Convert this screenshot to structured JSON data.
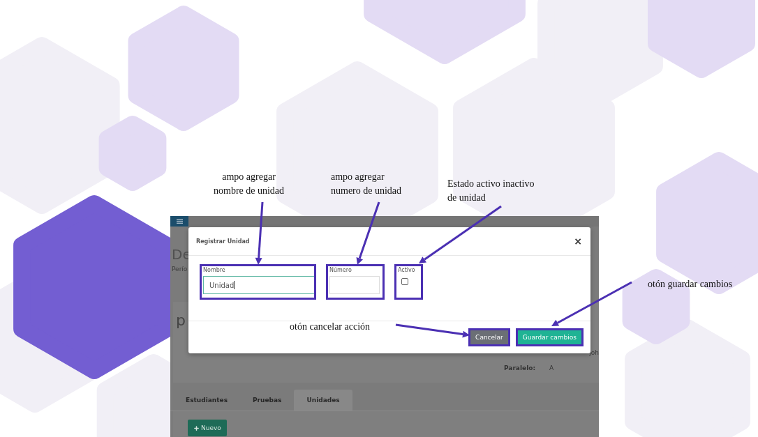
{
  "annotations": [
    {
      "text": "ampo agregar\nnombre de unidad"
    },
    {
      "text": "ampo agregar\nnumero de unidad"
    },
    {
      "text": "Estado activo inactivo\nde unidad"
    },
    {
      "text": "otón cancelar acción"
    },
    {
      "text": "otón guardar cambios"
    }
  ],
  "app": {
    "title": "De",
    "subtitle": "Perío",
    "heading": "p",
    "side_text": "joh",
    "paralelo_label": "Paralelo:",
    "paralelo_value": "A",
    "tabs": [
      {
        "label": "Estudiantes",
        "selected": false
      },
      {
        "label": "Pruebas",
        "selected": false
      },
      {
        "label": "Unidades",
        "selected": true
      }
    ],
    "new_button": {
      "label": "Nuevo"
    }
  },
  "modal": {
    "title": "Registrar Unidad",
    "close": "×",
    "fields": [
      {
        "kind": "text",
        "label": "Nombre",
        "value": "Unidad",
        "focused": true
      },
      {
        "kind": "text",
        "label": "Número",
        "focused": false
      },
      {
        "kind": "checkbox",
        "label": "Activo",
        "checked": false
      }
    ],
    "buttons": [
      {
        "kind": "secondary",
        "label": "Cancelar"
      },
      {
        "kind": "primary",
        "label": "Guardar cambios"
      }
    ]
  }
}
